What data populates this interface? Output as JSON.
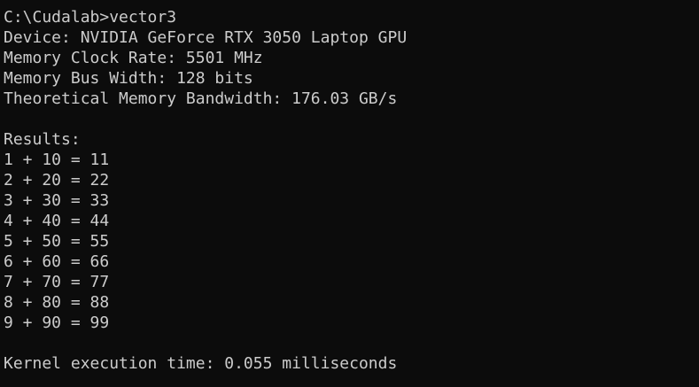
{
  "terminal": {
    "prompt_line": "C:\\Cudalab>vector3",
    "device": "Device: NVIDIA GeForce RTX 3050 Laptop GPU",
    "memory_clock": "Memory Clock Rate: 5501 MHz",
    "memory_bus": "Memory Bus Width: 128 bits",
    "bandwidth": "Theoretical Memory Bandwidth: 176.03 GB/s",
    "results_header": "Results:",
    "results": [
      "1 + 10 = 11",
      "2 + 20 = 22",
      "3 + 30 = 33",
      "4 + 40 = 44",
      "5 + 50 = 55",
      "6 + 60 = 66",
      "7 + 70 = 77",
      "8 + 80 = 88",
      "9 + 90 = 99"
    ],
    "kernel_time": "Kernel execution time: 0.055 milliseconds"
  }
}
